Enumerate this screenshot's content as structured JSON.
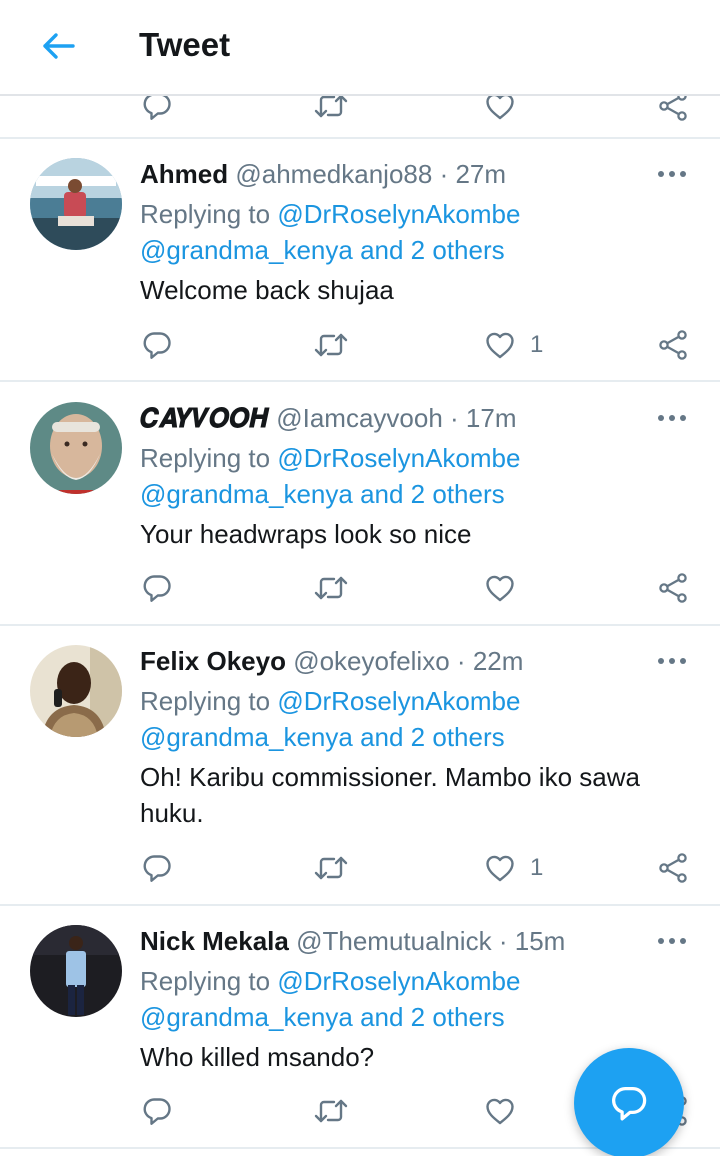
{
  "header": {
    "title": "Tweet",
    "back_icon": "arrow-left-icon"
  },
  "colors": {
    "accent": "#1da1f2",
    "link": "#1b95e0",
    "secondary_text": "#657786",
    "divider": "#e6ecf0"
  },
  "tweets": [
    {
      "name": "Ahmed",
      "handle": "@ahmedkanjo88",
      "sep": "·",
      "time": "27m",
      "replying_prefix": "Replying to",
      "replying_user": "@DrRoselynAkombe",
      "replying_rest": "@grandma_kenya and 2 others",
      "text": "Welcome back shujaa",
      "like_count": "1"
    },
    {
      "name": "𝑪𝑨𝒀𝑽𝑶𝑶𝑯",
      "handle": "@Iamcayvooh",
      "sep": "·",
      "time": "17m",
      "replying_prefix": "Replying to",
      "replying_user": "@DrRoselynAkombe",
      "replying_rest": "@grandma_kenya and 2 others",
      "text": "Your headwraps look so nice",
      "like_count": ""
    },
    {
      "name": "Felix Okeyo",
      "handle": "@okeyofelixo",
      "sep": "·",
      "time": "22m",
      "replying_prefix": "Replying to",
      "replying_user": "@DrRoselynAkombe",
      "replying_rest": "@grandma_kenya and 2 others",
      "text": "Oh! Karibu commissioner. Mambo iko sawa huku.",
      "like_count": "1"
    },
    {
      "name": "Nick Mekala",
      "handle": "@Themutualnick",
      "sep": "·",
      "time": "15m",
      "replying_prefix": "Replying to",
      "replying_user": "@DrRoselynAkombe",
      "replying_rest": "@grandma_kenya and 2 others",
      "text": "Who killed msando?",
      "like_count": ""
    }
  ],
  "icons": {
    "reply": "reply-icon",
    "retweet": "retweet-icon",
    "like": "heart-icon",
    "share": "share-icon",
    "more": "more-options-icon",
    "compose": "compose-reply-icon"
  }
}
